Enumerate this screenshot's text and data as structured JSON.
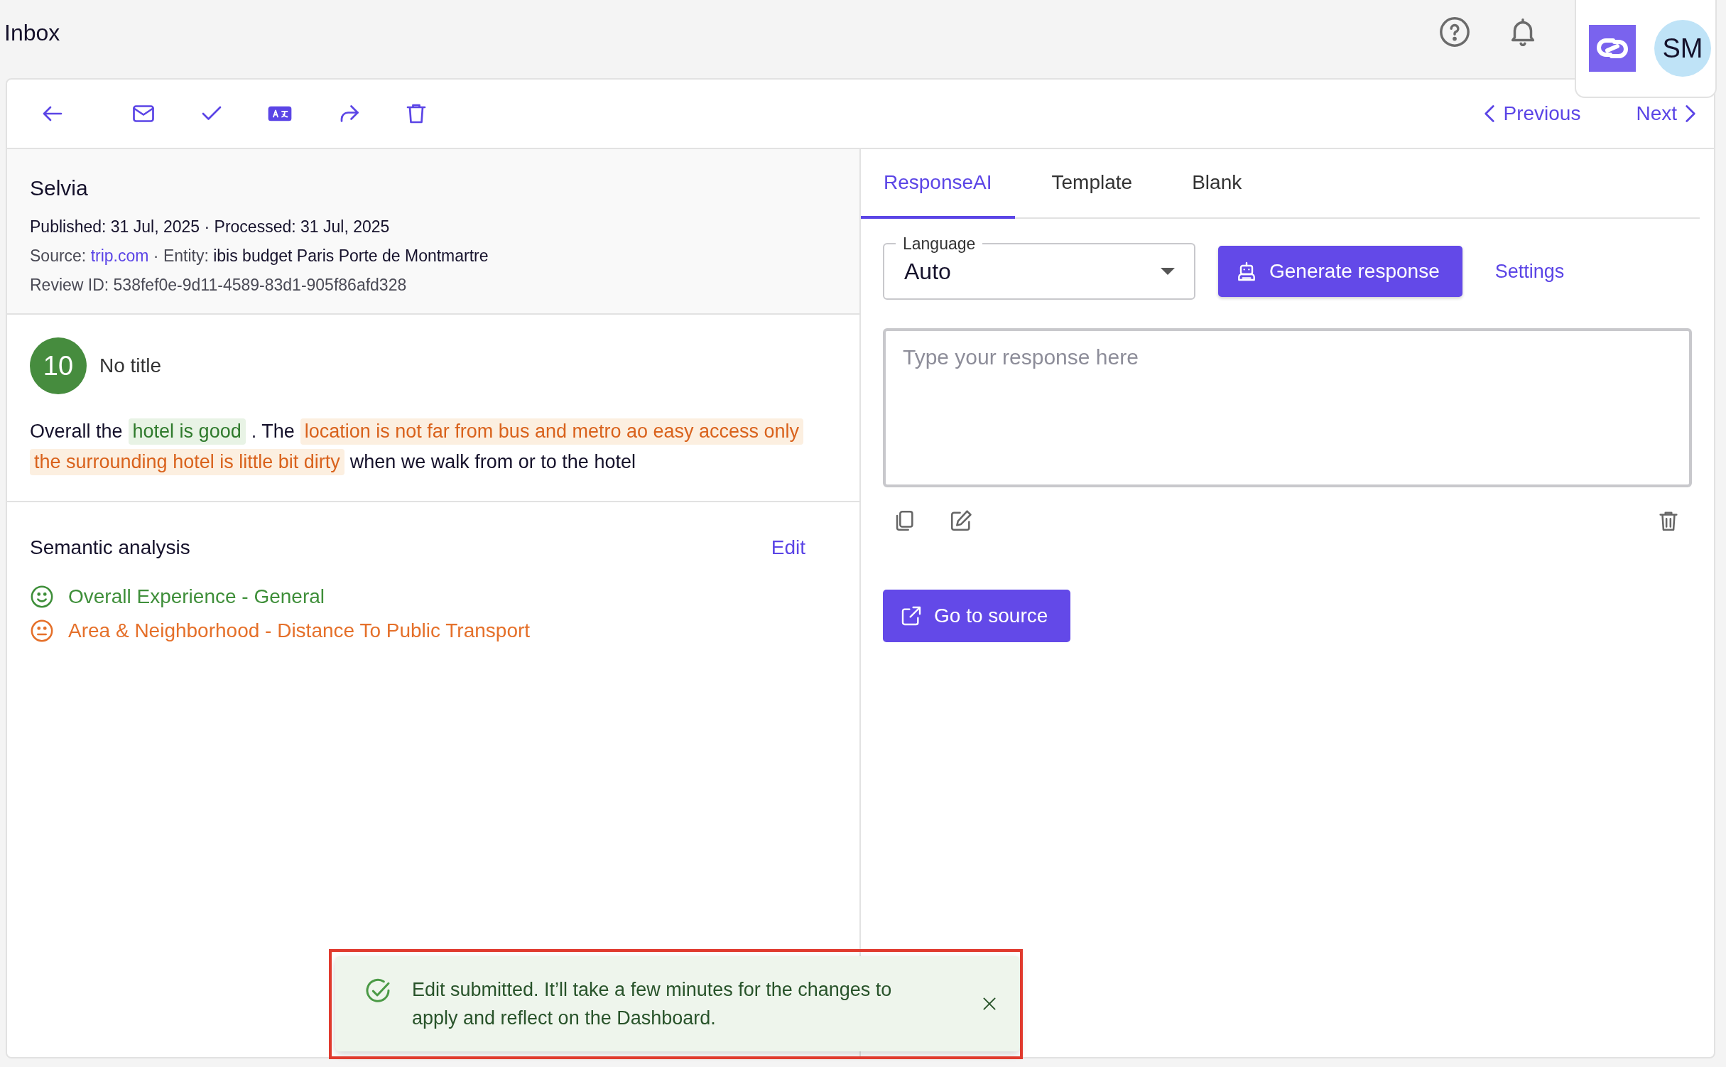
{
  "page": {
    "title": "Inbox"
  },
  "account": {
    "initials": "SM"
  },
  "navigation": {
    "previous": "Previous",
    "next": "Next"
  },
  "review": {
    "author": "Selvia",
    "dates": "Published: 31 Jul, 2025 · Processed: 31 Jul, 2025",
    "source_label": "Source:",
    "source": "trip.com",
    "entity_label": "· Entity:",
    "entity": "ibis budget Paris Porte de Montmartre",
    "review_id": "Review ID: 538fef0e-9d11-4589-83d1-905f86afd328",
    "score": "10",
    "title": "No title",
    "lines": [
      [
        {
          "kind": "plain",
          "text": "Overall the"
        },
        {
          "kind": "positive",
          "text": "hotel is good"
        },
        {
          "kind": "plain",
          "text": ". The"
        },
        {
          "kind": "negative",
          "text": "location is not far from bus and metro ao easy access only"
        }
      ],
      [
        {
          "kind": "negative",
          "text": "the surrounding hotel is little bit dirty"
        },
        {
          "kind": "plain",
          "text": "when we walk from or to the hotel"
        }
      ]
    ]
  },
  "semantic_analysis": {
    "heading": "Semantic analysis",
    "edit": "Edit",
    "topics": [
      {
        "kind": "smile",
        "color": "#3f8f3a",
        "label": "Overall Experience - General"
      },
      {
        "kind": "neutral",
        "color": "#e5702a",
        "label": "Area & Neighborhood - Distance To Public Transport"
      }
    ]
  },
  "response": {
    "tabs": [
      {
        "label": "ResponseAI",
        "selected": true
      },
      {
        "label": "Template",
        "selected": false
      },
      {
        "label": "Blank",
        "selected": false
      }
    ],
    "language_label": "Language",
    "language": "Auto",
    "generate": "Generate response",
    "settings": "Settings",
    "placeholder": "Type your response here",
    "go_to_source": "Go to source"
  },
  "toast": {
    "message": "Edit submitted. It’ll take a few minutes for the changes to apply and reflect on the Dashboard."
  }
}
